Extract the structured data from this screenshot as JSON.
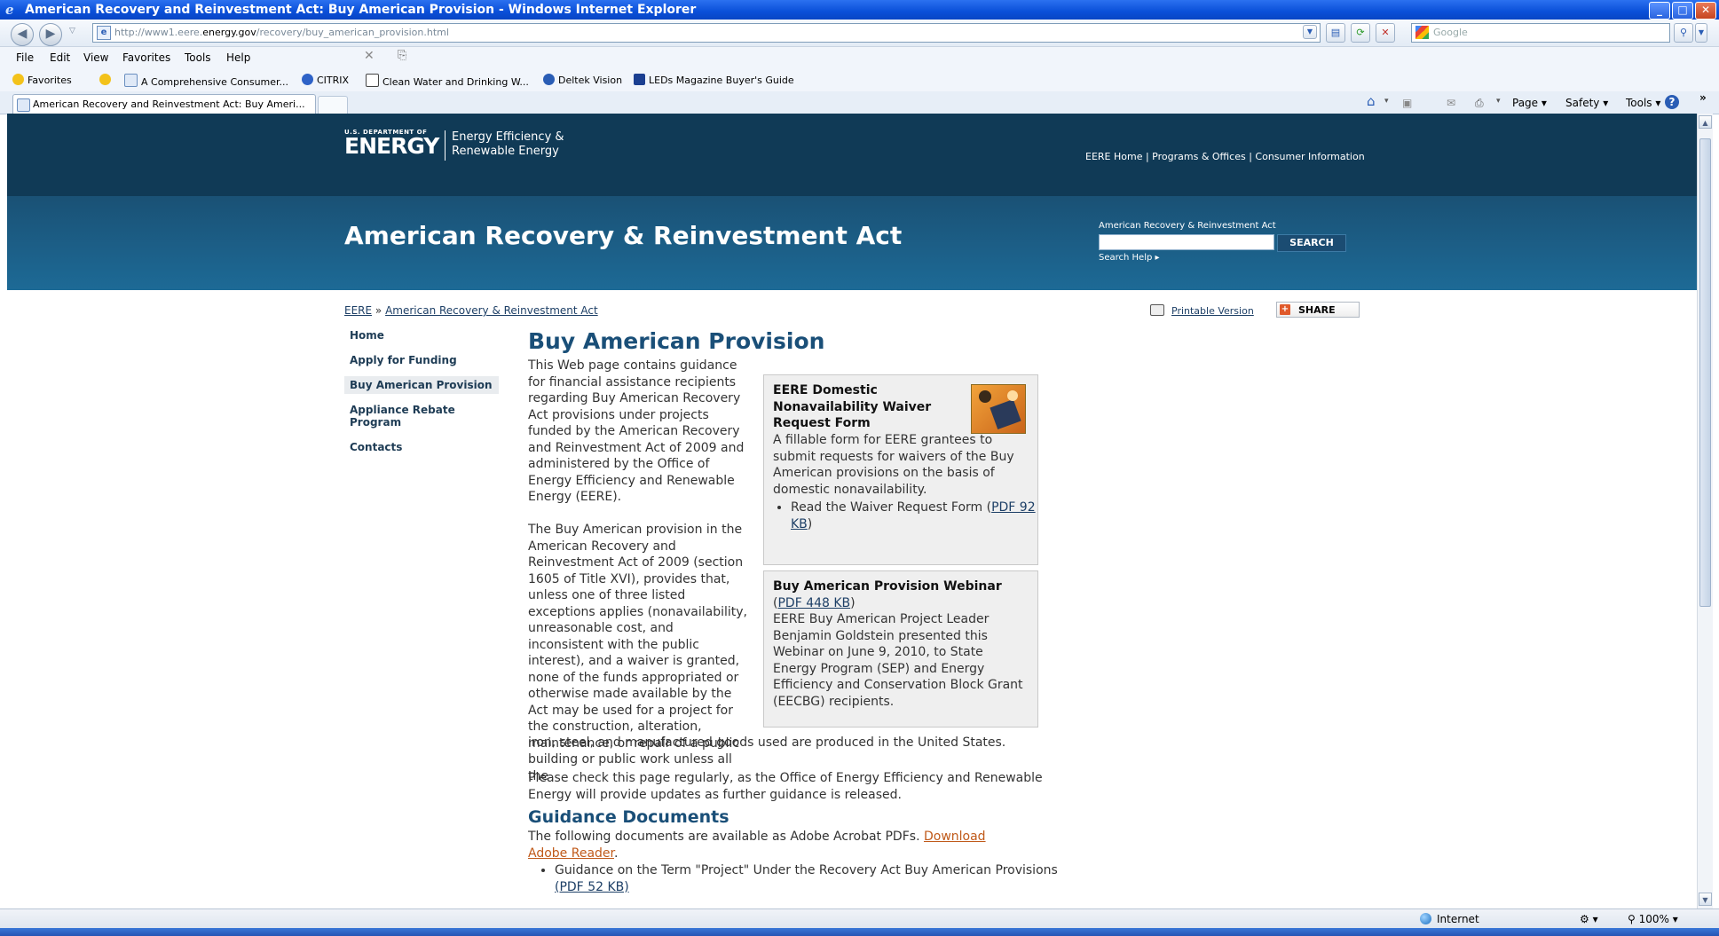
{
  "window": {
    "title": "American Recovery and Reinvestment Act: Buy American Provision - Windows Internet Explorer",
    "min_label": "_",
    "max_label": "□",
    "close_label": "✕"
  },
  "address": {
    "url_prefix": "http://www1.eere.",
    "url_domain": "energy.gov",
    "url_path": "/recovery/buy_american_provision.html",
    "search_placeholder": "Google"
  },
  "menu": [
    "File",
    "Edit",
    "View",
    "Favorites",
    "Tools",
    "Help"
  ],
  "favorites": {
    "label": "Favorites",
    "items": [
      "A Comprehensive Consumer...",
      "CITRIX",
      "Clean Water and Drinking W...",
      "Deltek Vision",
      "LEDs Magazine Buyer's Guide"
    ]
  },
  "tab": {
    "label": "American Recovery and Reinvestment Act: Buy Ameri..."
  },
  "commandbar": {
    "page": "Page",
    "safety": "Safety",
    "tools": "Tools",
    "help": "?"
  },
  "site": {
    "dept": "U.S. DEPARTMENT OF",
    "energy": "ENERGY",
    "eere_line1": "Energy Efficiency &",
    "eere_line2": "Renewable Energy",
    "toplinks": "EERE Home | Programs & Offices | Consumer Information",
    "page_title": "American Recovery & Reinvestment Act",
    "search_label": "American Recovery & Reinvestment Act",
    "search_button": "SEARCH",
    "search_help": "Search Help ▸"
  },
  "breadcrumb": {
    "home": "EERE",
    "sep": " » ",
    "current": "American Recovery & Reinvestment Act"
  },
  "printable": "Printable Version",
  "share": "SHARE",
  "nav": [
    "Home",
    "Apply for Funding",
    "Buy American Provision",
    "Appliance Rebate Program",
    "Contacts"
  ],
  "content": {
    "heading": "Buy American Provision",
    "intro": "This Web page contains guidance for financial assistance recipients regarding Buy American Recovery Act provisions under projects funded by the American Recovery and Reinvestment Act of 2009 and administered by the Office of Energy Efficiency and Renewable Energy (EERE).",
    "para2a": "The Buy American provision in the American Recovery and Reinvestment Act of 2009 (section 1605 of Title XVI), provides that, unless one of three listed exceptions applies (nonavailability, unreasonable cost, and inconsistent with the public interest), and a waiver is granted, none of the funds appropriated or otherwise made available by the Act may be used for a project for the construction, alteration, maintenance, or repair of a public building or public work unless all the",
    "para2b": "iron, steel, and manufactured goods used are produced in the United States.",
    "para3": "Please check this page regularly, as the Office of Energy Efficiency and Renewable Energy will provide updates as further guidance is released.",
    "guidance_heading": "Guidance Documents",
    "guidance_intro": "The following documents are available as Adobe Acrobat PDFs. ",
    "guidance_link": "Download Adobe Reader",
    "guidance_link_end": ".",
    "guidance_item": "Guidance on the Term \"Project\" Under the Recovery Act Buy American Provisions",
    "guidance_item_pdf": "(PDF 52 KB)"
  },
  "box1": {
    "title": "EERE Domestic Nonavailability Waiver Request Form",
    "body": "A fillable form for EERE grantees to submit requests for waivers of the Buy American provisions on the basis of domestic nonavailability.",
    "item_text": "Read the Waiver Request Form (",
    "item_link": "PDF 92 KB",
    "item_end": ")"
  },
  "box2": {
    "title": "Buy American Provision Webinar",
    "title_paren_open": " (",
    "title_link": "PDF 448 KB",
    "title_paren_close": ")",
    "body": "EERE Buy American Project Leader Benjamin Goldstein presented this Webinar on June 9, 2010, to State Energy Program (SEP) and Energy Efficiency and Conservation Block Grant (EECBG) recipients."
  },
  "status": {
    "zone": "Internet",
    "zoom": "100%"
  }
}
